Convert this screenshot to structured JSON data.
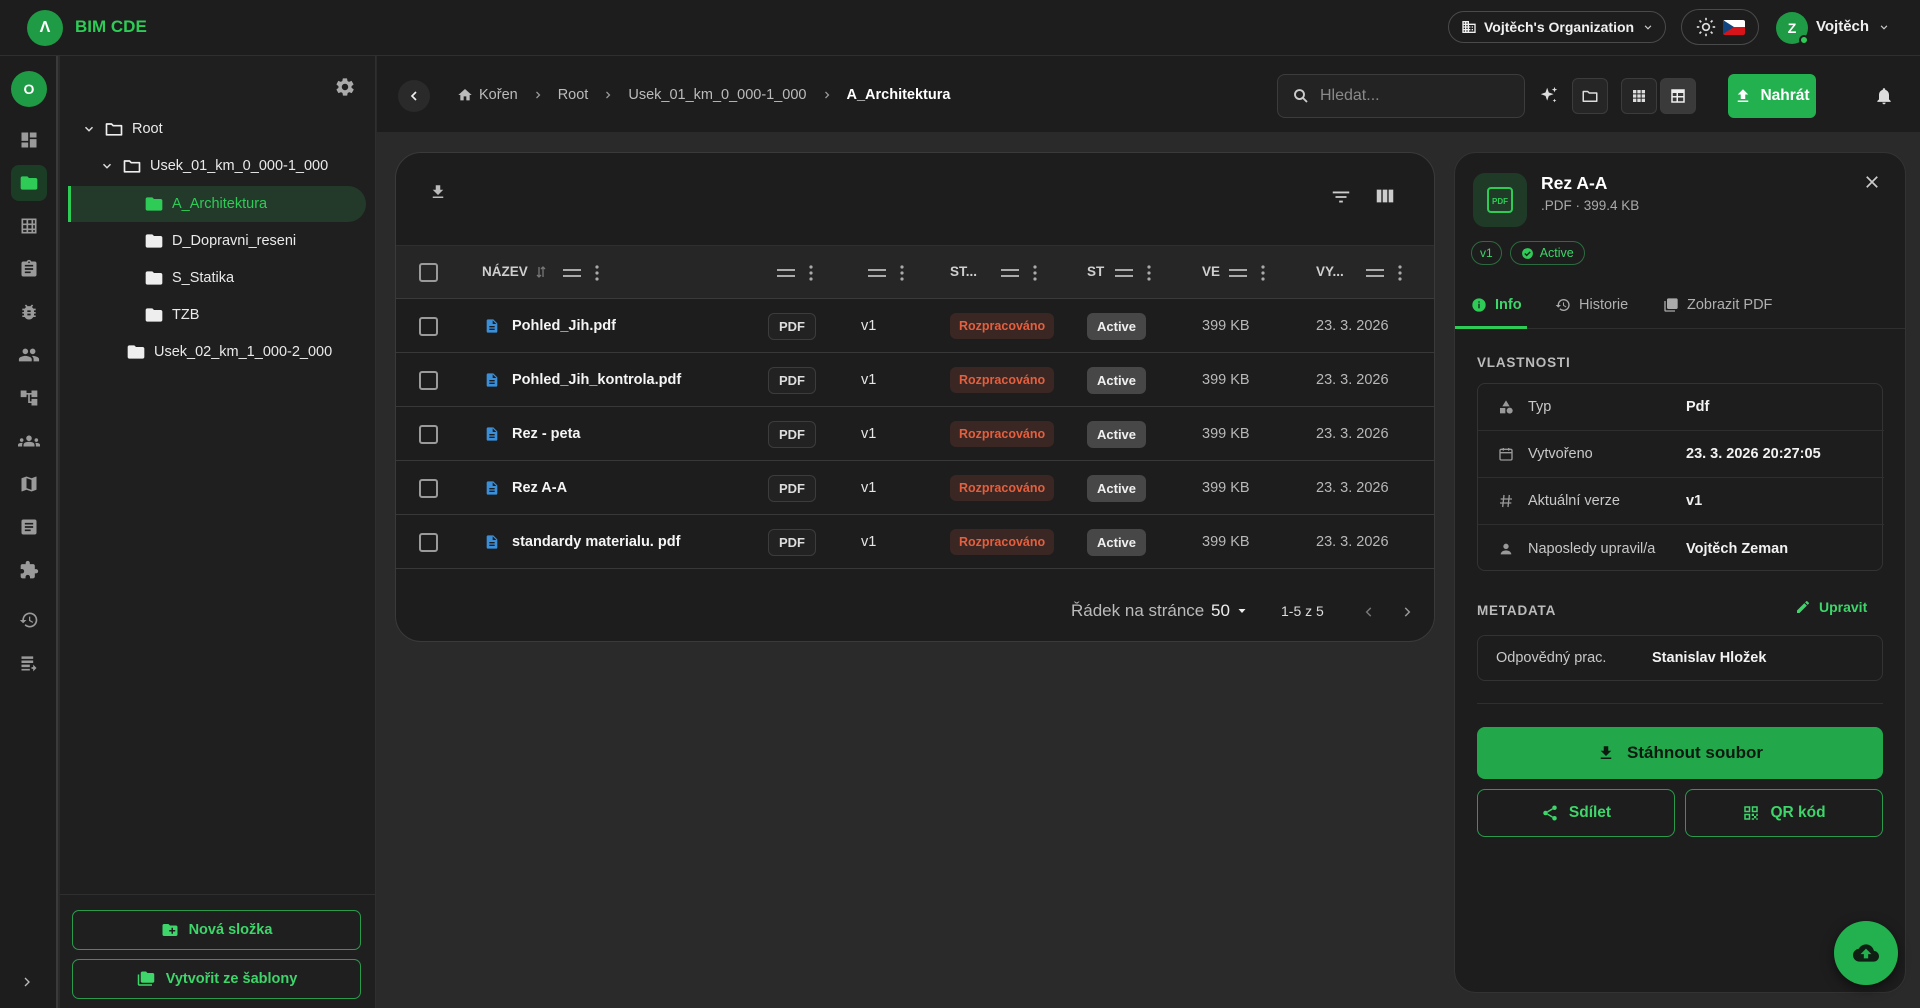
{
  "app": {
    "brand": "BIM CDE",
    "logo_letter": "Λ"
  },
  "topbar": {
    "organization": "Vojtěch's Organization",
    "user_initial": "Z",
    "user_name": "Vojtěch"
  },
  "rail": {
    "avatar_letter": "O",
    "items": [
      "dashboard-icon",
      "folder-icon",
      "table-icon",
      "clipboard-icon",
      "bug-icon",
      "people-icon",
      "hierarchy-icon",
      "team-icon",
      "map-icon",
      "document-list-icon",
      "puzzle-icon",
      "history-icon",
      "archive-icon"
    ]
  },
  "folders": {
    "tree": [
      {
        "label": "Root"
      },
      {
        "label": "Usek_01_km_0_000-1_000"
      },
      {
        "label": "A_Architektura"
      },
      {
        "label": "D_Dopravni_reseni"
      },
      {
        "label": "S_Statika"
      },
      {
        "label": "TZB"
      },
      {
        "label": "Usek_02_km_1_000-2_000"
      }
    ],
    "new_folder": "Nová složka",
    "from_template": "Vytvořit ze šablony"
  },
  "toolbar": {
    "breadcrumbs": [
      "Kořen",
      "Root",
      "Usek_01_km_0_000-1_000",
      "A_Architektura"
    ],
    "search_placeholder": "Hledat...",
    "upload": "Nahrát"
  },
  "table": {
    "headers": {
      "name": "NÁZEV",
      "status": "ST...",
      "state": "ST",
      "size": "VE",
      "created": "VY..."
    },
    "rows": [
      {
        "name": "Pohled_Jih.pdf",
        "type": "PDF",
        "version": "v1",
        "status": "Rozpracováno",
        "state": "Active",
        "size": "399 KB",
        "date": "23. 3. 2026"
      },
      {
        "name": "Pohled_Jih_kontrola.pdf",
        "type": "PDF",
        "version": "v1",
        "status": "Rozpracováno",
        "state": "Active",
        "size": "399 KB",
        "date": "23. 3. 2026"
      },
      {
        "name": "Rez - peta",
        "type": "PDF",
        "version": "v1",
        "status": "Rozpracováno",
        "state": "Active",
        "size": "399 KB",
        "date": "23. 3. 2026"
      },
      {
        "name": "Rez A-A",
        "type": "PDF",
        "version": "v1",
        "status": "Rozpracováno",
        "state": "Active",
        "size": "399 KB",
        "date": "23. 3. 2026"
      },
      {
        "name": "standardy materialu. pdf",
        "type": "PDF",
        "version": "v1",
        "status": "Rozpracováno",
        "state": "Active",
        "size": "399 KB",
        "date": "23. 3. 2026"
      }
    ],
    "pager": {
      "rows_label": "Řádek na stránce",
      "rows_value": "50",
      "range": "1-5 z 5"
    }
  },
  "detail": {
    "title": "Rez A-A",
    "subtitle": ".PDF · 399.4 KB",
    "thumb_label": "PDF",
    "version_chip": "v1",
    "active_chip": "Active",
    "tabs": [
      "Info",
      "Historie",
      "Zobrazit PDF"
    ],
    "properties_heading": "VLASTNOSTI",
    "properties": [
      {
        "label": "Typ",
        "value": "Pdf",
        "icon": "shapes-icon"
      },
      {
        "label": "Vytvořeno",
        "value": "23. 3. 2026 20:27:05",
        "icon": "calendar-icon"
      },
      {
        "label": "Aktuální verze",
        "value": "v1",
        "icon": "hash-icon"
      },
      {
        "label": "Naposledy upravil/a",
        "value": "Vojtěch Zeman",
        "icon": "person-icon"
      }
    ],
    "metadata_heading": "METADATA",
    "edit": "Upravit",
    "metadata": {
      "label": "Odpovědný prac.",
      "value": "Stanislav Hložek"
    },
    "download": "Stáhnout soubor",
    "share": "Sdílet",
    "qr": "QR kód"
  },
  "colors": {
    "accent": "#23b14f",
    "accent_text": "#2ecc57",
    "status_orange": "#e2603f",
    "background": "#2a2a2a",
    "surface": "#1d1d1d"
  }
}
